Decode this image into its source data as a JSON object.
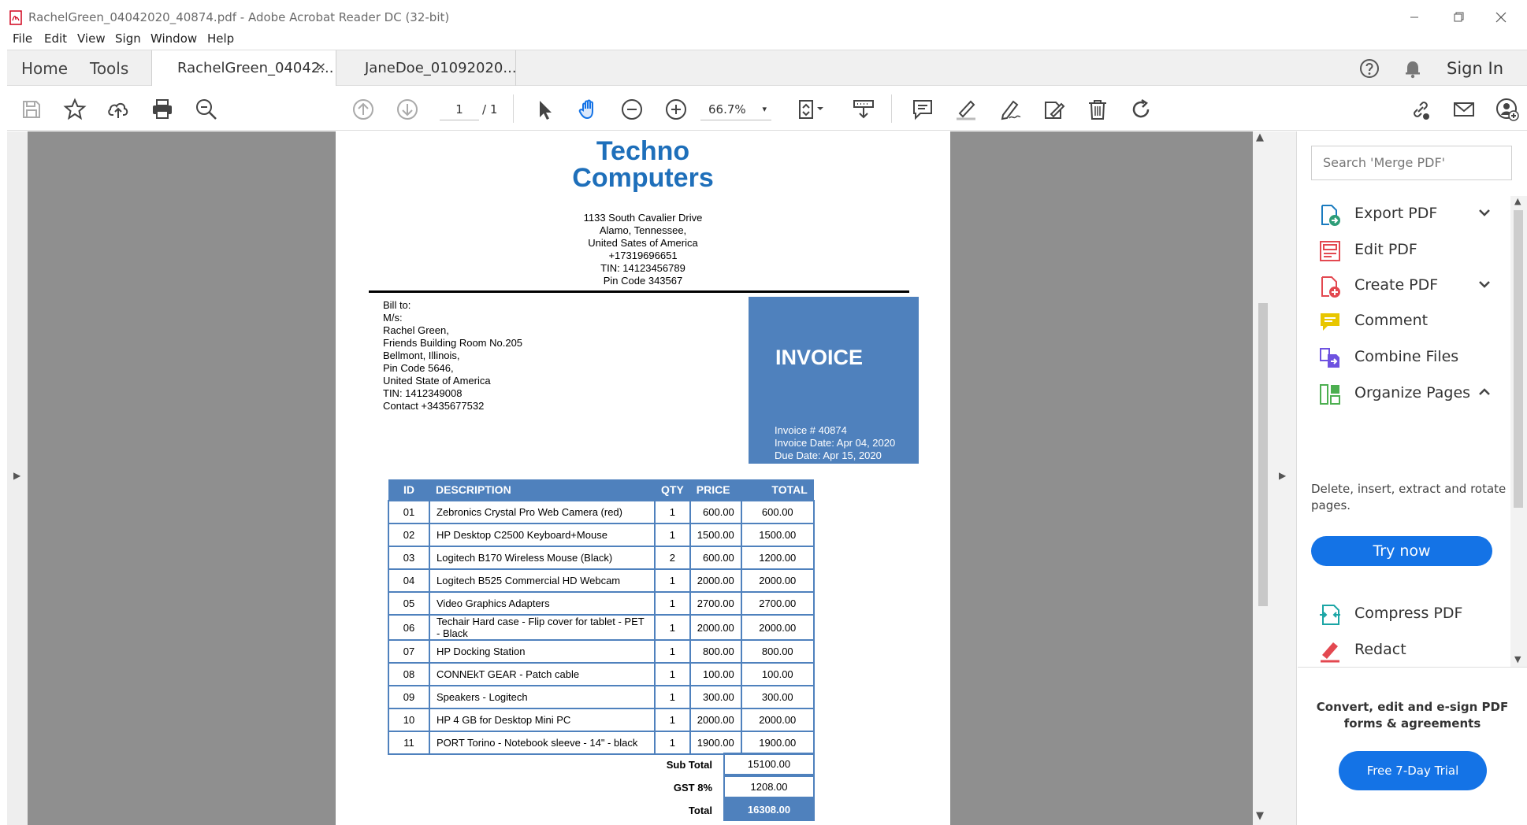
{
  "window": {
    "title": "RachelGreen_04042020_40874.pdf - Adobe Acrobat Reader DC (32-bit)"
  },
  "menu": [
    "File",
    "Edit",
    "View",
    "Sign",
    "Window",
    "Help"
  ],
  "tabs": {
    "home": "Home",
    "tools": "Tools",
    "docs": [
      {
        "label": "RachelGreen_04042...",
        "close": "×"
      },
      {
        "label": "JaneDoe_01092020..."
      }
    ],
    "sign_in": "Sign In"
  },
  "toolbar": {
    "page_current": "1",
    "page_total": "/ 1",
    "zoom": "66.7%",
    "zoom_caret": "▾"
  },
  "document": {
    "company_line1": "Techno",
    "company_line2": "Computers",
    "address": [
      "1133 South Cavalier Drive",
      "Alamo, Tennessee,",
      "United Sates of America",
      "+17319696651",
      "TIN: 14123456789",
      "Pin Code 343567"
    ],
    "bill_to": [
      "Bill to:",
      "M/s:",
      "Rachel Green,",
      "Friends Building Room No.205",
      "Bellmont, Illinois,",
      "Pin Code 5646,",
      "United State of America",
      "TIN: 1412349008",
      "Contact +3435677532"
    ],
    "invoice_title": "INVOICE",
    "invoice_meta": [
      "Invoice # 40874",
      "Invoice Date: Apr 04, 2020",
      "Due Date: Apr 15, 2020"
    ],
    "table_headers": [
      "ID",
      "DESCRIPTION",
      "QTY",
      "PRICE",
      "TOTAL"
    ],
    "rows": [
      [
        "01",
        "Zebronics Crystal Pro Web Camera (red)",
        "1",
        "600.00",
        "600.00"
      ],
      [
        "02",
        "HP Desktop C2500 Keyboard+Mouse",
        "1",
        "1500.00",
        "1500.00"
      ],
      [
        "03",
        "Logitech B170 Wireless Mouse (Black)",
        "2",
        "600.00",
        "1200.00"
      ],
      [
        "04",
        "Logitech B525 Commercial HD Webcam",
        "1",
        "2000.00",
        "2000.00"
      ],
      [
        "05",
        "Video Graphics Adapters",
        "1",
        "2700.00",
        "2700.00"
      ],
      [
        "06",
        "Techair Hard case - Flip cover for tablet - PET - Black",
        "1",
        "2000.00",
        "2000.00"
      ],
      [
        "07",
        "HP Docking Station",
        "1",
        "800.00",
        "800.00"
      ],
      [
        "08",
        "CONNEkT GEAR - Patch cable",
        "1",
        "100.00",
        "100.00"
      ],
      [
        "09",
        "Speakers - Logitech",
        "1",
        "300.00",
        "300.00"
      ],
      [
        "10",
        "HP 4 GB for Desktop Mini PC",
        "1",
        "2000.00",
        "2000.00"
      ],
      [
        "11",
        "PORT Torino - Notebook sleeve - 14\" - black",
        "1",
        "1900.00",
        "1900.00"
      ]
    ],
    "subtotal_label": "Sub Total",
    "subtotal": "15100.00",
    "gst_label": "GST 8%",
    "gst": "1208.00",
    "total_label": "Total",
    "total": "16308.00"
  },
  "right_panel": {
    "search_placeholder": "Search 'Merge PDF'",
    "tools": [
      {
        "label": "Export PDF",
        "icon": "export-pdf-icon",
        "color": "#2d9d78"
      },
      {
        "label": "Edit PDF",
        "icon": "edit-pdf-icon",
        "color": "#e34850"
      },
      {
        "label": "Create PDF",
        "icon": "create-pdf-icon",
        "color": "#e34850"
      },
      {
        "label": "Comment",
        "icon": "comment-icon",
        "color": "#e8c600"
      },
      {
        "label": "Combine Files",
        "icon": "combine-files-icon",
        "color": "#6e52e0"
      },
      {
        "label": "Organize Pages",
        "icon": "organize-pages-icon",
        "color": "#4caf50"
      },
      {
        "label": "Compress PDF",
        "icon": "compress-pdf-icon",
        "color": "#1aa5a5"
      },
      {
        "label": "Redact",
        "icon": "redact-icon",
        "color": "#e34850"
      }
    ],
    "organize_desc": "Delete, insert, extract and rotate pages.",
    "try_now": "Try now",
    "promo_text": "Convert, edit and e-sign PDF forms & agreements",
    "trial_button": "Free 7-Day Trial"
  },
  "colors": {
    "accent": "#1473e6",
    "invoice_blue": "#4f81bd",
    "company_blue": "#1e6fba",
    "doc_background": "#8f8f8f"
  }
}
